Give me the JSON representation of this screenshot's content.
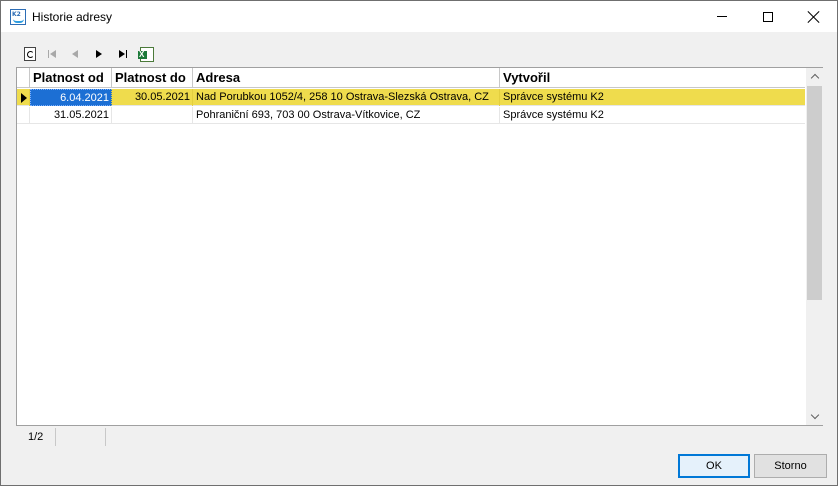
{
  "window": {
    "title": "Historie adresy"
  },
  "toolbar": {
    "icons": [
      "refresh-icon",
      "first-record-icon",
      "previous-record-icon",
      "next-record-icon",
      "last-record-icon",
      "excel-export-icon"
    ]
  },
  "grid": {
    "columns": [
      "Platnost od",
      "Platnost do",
      "Adresa",
      "Vytvořil"
    ],
    "rows": [
      {
        "od": "6.04.2021",
        "do": "30.05.2021",
        "adresa": "Nad Porubkou 1052/4, 258 10  Ostrava-Slezská Ostrava, CZ",
        "vytvoril": "Správce systému K2",
        "selected": true
      },
      {
        "od": "31.05.2021",
        "do": "",
        "adresa": "Pohraniční 693, 703 00  Ostrava-Vítkovice, CZ",
        "vytvoril": "Správce systému K2",
        "selected": false
      }
    ],
    "highlight_color": "#efdc4d",
    "focus_color": "#1c6fd4"
  },
  "status": {
    "count": "1/2"
  },
  "buttons": {
    "ok": "OK",
    "cancel": "Storno"
  }
}
